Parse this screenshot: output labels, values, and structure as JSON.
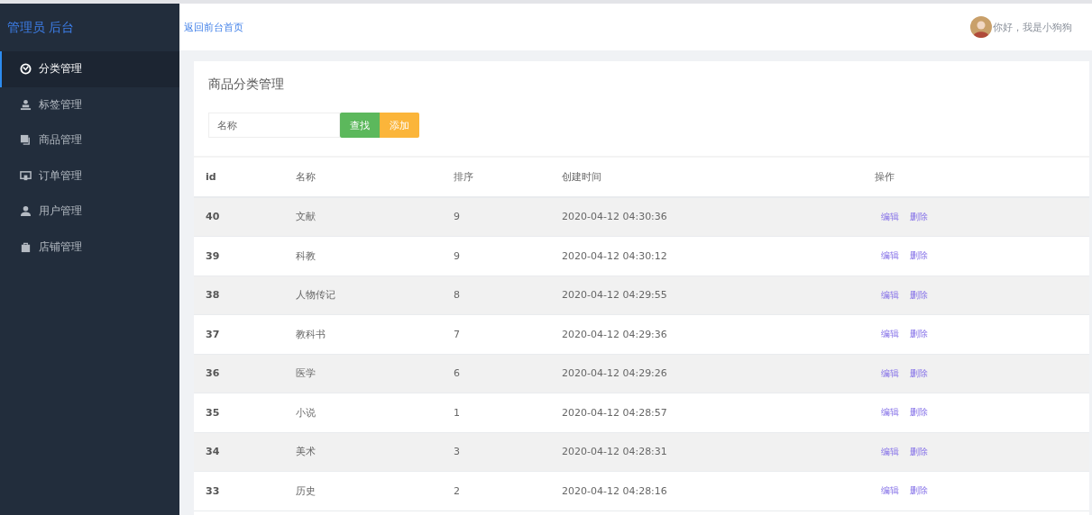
{
  "sidebar": {
    "brand": "管理员 后台",
    "items": [
      {
        "label": "分类管理",
        "selected": true
      },
      {
        "label": "标签管理",
        "selected": false
      },
      {
        "label": "商品管理",
        "selected": false
      },
      {
        "label": "订单管理",
        "selected": false
      },
      {
        "label": "用户管理",
        "selected": false
      },
      {
        "label": "店铺管理",
        "selected": false
      }
    ]
  },
  "header": {
    "home_link": "返回前台首页",
    "greeting": "你好，我是小狗狗"
  },
  "card": {
    "title": "商品分类管理",
    "search": {
      "placeholder": "名称"
    },
    "buttons": [
      {
        "label": "查找",
        "kind": "search"
      },
      {
        "label": "添加",
        "kind": "add"
      }
    ]
  },
  "table": {
    "columns": [
      "id",
      "名称",
      "排序",
      "创建时间",
      "操作"
    ],
    "rows": [
      {
        "id": "40",
        "name": "文献",
        "order": "9",
        "created": "2020-04-12 04:30:36",
        "actions": [
          "编辑",
          "删除"
        ]
      },
      {
        "id": "39",
        "name": "科教",
        "order": "9",
        "created": "2020-04-12 04:30:12",
        "actions": [
          "编辑",
          "删除"
        ]
      },
      {
        "id": "38",
        "name": "人物传记",
        "order": "8",
        "created": "2020-04-12 04:29:55",
        "actions": [
          "编辑",
          "删除"
        ]
      },
      {
        "id": "37",
        "name": "教科书",
        "order": "7",
        "created": "2020-04-12 04:29:36",
        "actions": [
          "编辑",
          "删除"
        ]
      },
      {
        "id": "36",
        "name": "医学",
        "order": "6",
        "created": "2020-04-12 04:29:26",
        "actions": [
          "编辑",
          "删除"
        ]
      },
      {
        "id": "35",
        "name": "小说",
        "order": "1",
        "created": "2020-04-12 04:28:57",
        "actions": [
          "编辑",
          "删除"
        ]
      },
      {
        "id": "34",
        "name": "美术",
        "order": "3",
        "created": "2020-04-12 04:28:31",
        "actions": [
          "编辑",
          "删除"
        ]
      },
      {
        "id": "33",
        "name": "历史",
        "order": "2",
        "created": "2020-04-12 04:28:16",
        "actions": [
          "编辑",
          "删除"
        ]
      }
    ]
  }
}
